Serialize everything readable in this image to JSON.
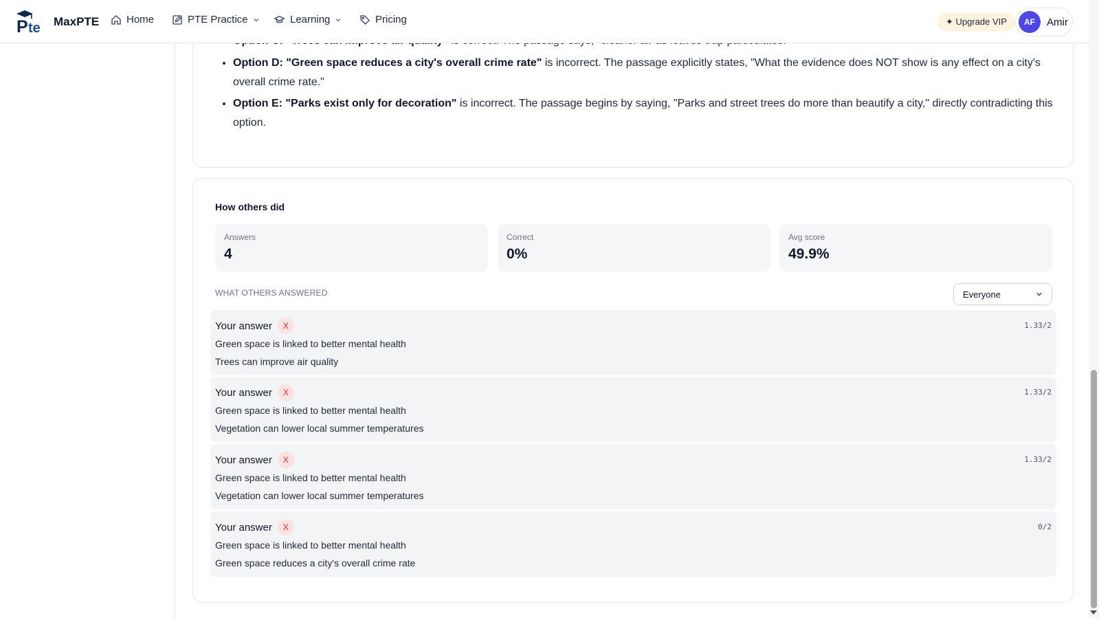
{
  "app": {
    "logo_text": "MaxPTE",
    "logo_mark_icon": "graduation-cap-pte-logo"
  },
  "nav": {
    "items": [
      {
        "label": "Home",
        "icon": "home-icon"
      },
      {
        "label": "PTE Practice",
        "icon": "edit-icon",
        "dropdown": true
      },
      {
        "label": "Learning",
        "icon": "graduation-cap-icon",
        "dropdown": true
      },
      {
        "label": "Pricing",
        "icon": "tag-icon"
      }
    ],
    "upgrade_label": "✦ Upgrade VIP",
    "user_initials": "AF",
    "user_name": "Amir"
  },
  "explanation": {
    "items": [
      {
        "bold": "Option C: \"Trees can improve air quality\"",
        "text": " is correct. The passage says, \"cleaner air as leaves trap particulates.\""
      },
      {
        "bold": "Option D: \"Green space reduces a city's overall crime rate\"",
        "text": " is incorrect. The passage explicitly states, \"What the evidence does NOT show is any effect on a city's overall crime rate.\""
      },
      {
        "bold": "Option E: \"Parks exist only for decoration\"",
        "text": " is incorrect. The passage begins by saying, \"Parks and street trees do more than beautify a city,\" directly contradicting this option."
      }
    ]
  },
  "stats": {
    "title": "How others did",
    "cards": [
      {
        "label": "Answers",
        "value": "4"
      },
      {
        "label": "Correct",
        "value": "0%"
      },
      {
        "label": "Avg score",
        "value": "49.9%"
      }
    ],
    "section_label": "WHAT OTHERS ANSWERED",
    "filter": {
      "selected": "Everyone"
    }
  },
  "answers": [
    {
      "label": "Your answer",
      "mark": "X",
      "score": "1.33/2",
      "lines": [
        "Green space is linked to better mental health",
        "Trees can improve air quality"
      ]
    },
    {
      "label": "Your answer",
      "mark": "X",
      "score": "1.33/2",
      "lines": [
        "Green space is linked to better mental health",
        "Vegetation can lower local summer temperatures"
      ]
    },
    {
      "label": "Your answer",
      "mark": "X",
      "score": "1.33/2",
      "lines": [
        "Green space is linked to better mental health",
        "Vegetation can lower local summer temperatures"
      ]
    },
    {
      "label": "Your answer",
      "mark": "X",
      "score": "0/2",
      "lines": [
        "Green space is linked to better mental health",
        "Green space reduces a city's overall crime rate"
      ]
    }
  ],
  "colors": {
    "accent": "#4f46e5",
    "upgrade_bg": "#fdf3e1",
    "wrong_badge_bg": "#fde2e2",
    "wrong_badge_fg": "#dc2626",
    "row_bg": "#f3f4f6"
  }
}
